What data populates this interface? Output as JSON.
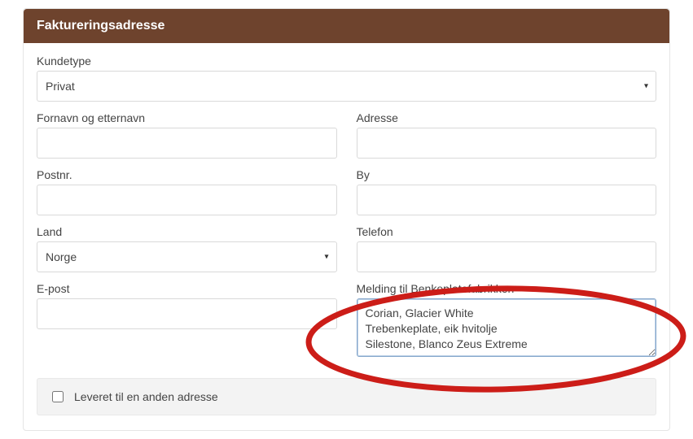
{
  "header": {
    "title": "Faktureringsadresse"
  },
  "fields": {
    "kundetype": {
      "label": "Kundetype",
      "value": "Privat"
    },
    "fornavn": {
      "label": "Fornavn og etternavn",
      "value": ""
    },
    "adresse": {
      "label": "Adresse",
      "value": ""
    },
    "postnr": {
      "label": "Postnr.",
      "value": ""
    },
    "by": {
      "label": "By",
      "value": ""
    },
    "land": {
      "label": "Land",
      "value": "Norge"
    },
    "telefon": {
      "label": "Telefon",
      "value": ""
    },
    "epost": {
      "label": "E-post",
      "value": ""
    },
    "melding": {
      "label": "Melding til Benkeplatefabrikken",
      "value": "Corian, Glacier White\nTrebenkeplate, eik hvitolje\nSilestone, Blanco Zeus Extreme"
    }
  },
  "other_address": {
    "label": "Leveret til en anden adresse",
    "checked": false
  }
}
